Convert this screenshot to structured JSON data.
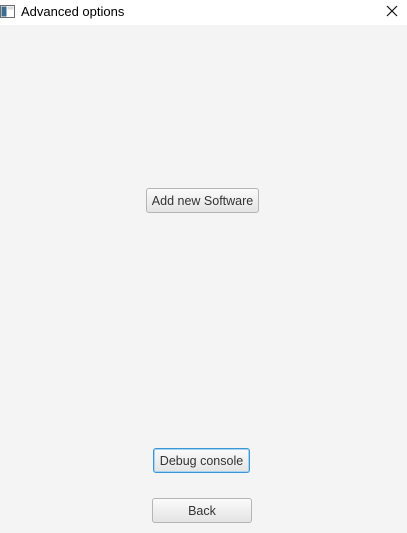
{
  "window": {
    "title": "Advanced options",
    "icons": {
      "app": "app-window-icon",
      "close": "close-icon"
    }
  },
  "buttons": {
    "add_software": "Add new Software",
    "debug_console": "Debug console",
    "back": "Back"
  },
  "colors": {
    "background": "#f4f4f4",
    "titlebar": "#ffffff",
    "focus_border": "#3b96d6"
  }
}
